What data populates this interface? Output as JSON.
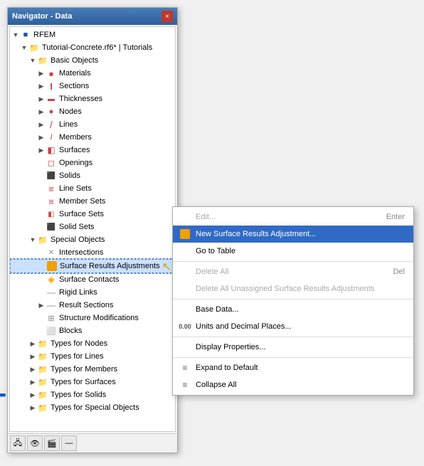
{
  "window": {
    "title": "Navigator - Data",
    "close_label": "×"
  },
  "tree": {
    "root_label": "RFEM",
    "tutorial_label": "Tutorial-Concrete.rf6* | Tutorials",
    "basic_objects_label": "Basic Objects",
    "items": [
      {
        "id": "materials",
        "label": "Materials",
        "icon": "material",
        "indent": 3,
        "hasChildren": true
      },
      {
        "id": "sections",
        "label": "Sections",
        "icon": "section",
        "indent": 3,
        "hasChildren": true
      },
      {
        "id": "thicknesses",
        "label": "Thicknesses",
        "icon": "thickness",
        "indent": 3,
        "hasChildren": true
      },
      {
        "id": "nodes",
        "label": "Nodes",
        "icon": "node",
        "indent": 3,
        "hasChildren": true
      },
      {
        "id": "lines",
        "label": "Lines",
        "icon": "line",
        "indent": 3,
        "hasChildren": true
      },
      {
        "id": "members",
        "label": "Members",
        "icon": "member",
        "indent": 3,
        "hasChildren": true
      },
      {
        "id": "surfaces",
        "label": "Surfaces",
        "icon": "surface",
        "indent": 3,
        "hasChildren": true
      },
      {
        "id": "openings",
        "label": "Openings",
        "icon": "opening",
        "indent": 3,
        "hasChildren": false
      },
      {
        "id": "solids",
        "label": "Solids",
        "icon": "solid",
        "indent": 3,
        "hasChildren": false
      },
      {
        "id": "linesets",
        "label": "Line Sets",
        "icon": "lineset",
        "indent": 3,
        "hasChildren": false
      },
      {
        "id": "membersets",
        "label": "Member Sets",
        "icon": "memberset",
        "indent": 3,
        "hasChildren": false
      },
      {
        "id": "surfacesets",
        "label": "Surface Sets",
        "icon": "surfaceset",
        "indent": 3,
        "hasChildren": false
      },
      {
        "id": "solidsets",
        "label": "Solid Sets",
        "icon": "solidset",
        "indent": 3,
        "hasChildren": false
      },
      {
        "id": "special_objects",
        "label": "Special Objects",
        "icon": "folder",
        "indent": 2,
        "hasChildren": true
      },
      {
        "id": "intersections",
        "label": "Intersections",
        "icon": "intersection",
        "indent": 3,
        "hasChildren": false
      },
      {
        "id": "surfresults",
        "label": "Surface Results Adjustments",
        "icon": "surfresult",
        "indent": 3,
        "hasChildren": false,
        "highlighted": true
      },
      {
        "id": "surfcontacts",
        "label": "Surface Contacts",
        "icon": "surfcontact",
        "indent": 3,
        "hasChildren": false
      },
      {
        "id": "rigidlinks",
        "label": "Rigid Links",
        "icon": "rigidlink",
        "indent": 3,
        "hasChildren": false
      },
      {
        "id": "resultsections",
        "label": "Result Sections",
        "icon": "resultsection",
        "indent": 3,
        "hasChildren": true
      },
      {
        "id": "structmod",
        "label": "Structure Modifications",
        "icon": "structmod",
        "indent": 3,
        "hasChildren": false
      },
      {
        "id": "blocks",
        "label": "Blocks",
        "icon": "block",
        "indent": 3,
        "hasChildren": false
      },
      {
        "id": "types_nodes",
        "label": "Types for Nodes",
        "icon": "type_folder",
        "indent": 2,
        "hasChildren": true
      },
      {
        "id": "types_lines",
        "label": "Types for Lines",
        "icon": "type_folder",
        "indent": 2,
        "hasChildren": true
      },
      {
        "id": "types_members",
        "label": "Types for Members",
        "icon": "type_folder",
        "indent": 2,
        "hasChildren": true
      },
      {
        "id": "types_surfaces",
        "label": "Types for Surfaces",
        "icon": "type_folder",
        "indent": 2,
        "hasChildren": true
      },
      {
        "id": "types_solids",
        "label": "Types for Solids",
        "icon": "type_folder",
        "indent": 2,
        "hasChildren": true
      },
      {
        "id": "types_special",
        "label": "Types for Special Objects",
        "icon": "type_folder",
        "indent": 2,
        "hasChildren": true
      }
    ]
  },
  "toolbar": {
    "btn1": "🖧",
    "btn2": "👁",
    "btn3": "🎬",
    "btn4": "—"
  },
  "context_menu": {
    "items": [
      {
        "id": "edit",
        "label": "Edit...",
        "shortcut": "Enter",
        "icon": "",
        "disabled": true,
        "selected": false
      },
      {
        "id": "new_surface_results",
        "label": "New Surface Results Adjustment...",
        "shortcut": "",
        "icon": "surfresult",
        "disabled": false,
        "selected": true
      },
      {
        "id": "goto_table",
        "label": "Go to Table",
        "shortcut": "",
        "icon": "",
        "disabled": false,
        "selected": false
      },
      {
        "id": "separator1",
        "type": "separator"
      },
      {
        "id": "delete_all",
        "label": "Delete All",
        "shortcut": "Del",
        "icon": "",
        "disabled": true,
        "selected": false
      },
      {
        "id": "delete_unassigned",
        "label": "Delete All Unassigned Surface Results Adjustments",
        "shortcut": "",
        "icon": "",
        "disabled": true,
        "selected": false
      },
      {
        "id": "separator2",
        "type": "separator"
      },
      {
        "id": "base_data",
        "label": "Base Data...",
        "shortcut": "",
        "icon": "",
        "disabled": false,
        "selected": false
      },
      {
        "id": "units",
        "label": "Units and Decimal Places...",
        "shortcut": "",
        "icon": "units",
        "disabled": false,
        "selected": false
      },
      {
        "id": "separator3",
        "type": "separator"
      },
      {
        "id": "display_props",
        "label": "Display Properties...",
        "shortcut": "",
        "icon": "",
        "disabled": false,
        "selected": false
      },
      {
        "id": "separator4",
        "type": "separator"
      },
      {
        "id": "expand_default",
        "label": "Expand to Default",
        "shortcut": "",
        "icon": "expand",
        "disabled": false,
        "selected": false
      },
      {
        "id": "collapse_all",
        "label": "Collapse All",
        "shortcut": "",
        "icon": "collapse",
        "disabled": false,
        "selected": false
      }
    ]
  }
}
